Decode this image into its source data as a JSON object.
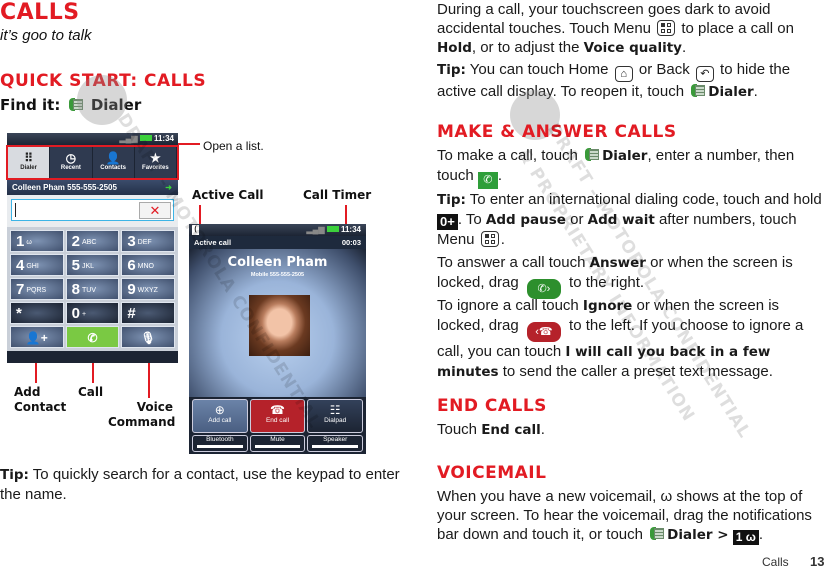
{
  "left": {
    "title": "Calls",
    "subtitle": "it’s goo to talk",
    "quick_start_heading": "Quick Start: Calls",
    "find_it_label": "Find it:",
    "find_it_app": "Dialer",
    "tip_label": "Tip:",
    "tip_text": " To quickly search for a contact, use the keypad to enter the name."
  },
  "phone_dialer": {
    "status_time": "11:34",
    "tabs": [
      {
        "label": "Dialer",
        "icon": "grid-icon",
        "active": true
      },
      {
        "label": "Recent",
        "icon": "clock-icon",
        "active": false
      },
      {
        "label": "Contacts",
        "icon": "person-icon",
        "active": false
      },
      {
        "label": "Favorites",
        "icon": "star-icon",
        "active": false
      }
    ],
    "contact_suggestion": "Colleen Pham 555-555-2505",
    "input_value": "",
    "keys": [
      {
        "digit": "1",
        "letters": "ω"
      },
      {
        "digit": "2",
        "letters": "ABC"
      },
      {
        "digit": "3",
        "letters": "DEF"
      },
      {
        "digit": "4",
        "letters": "GHI"
      },
      {
        "digit": "5",
        "letters": "JKL"
      },
      {
        "digit": "6",
        "letters": "MNO"
      },
      {
        "digit": "7",
        "letters": "PQRS"
      },
      {
        "digit": "8",
        "letters": "TUV"
      },
      {
        "digit": "9",
        "letters": "WXYZ"
      },
      {
        "digit": "*",
        "letters": ""
      },
      {
        "digit": "0",
        "letters": "+"
      },
      {
        "digit": "#",
        "letters": ""
      }
    ],
    "callouts": {
      "open_list": "Open a list.",
      "add_contact": "Add Contact",
      "call": "Call",
      "voice_command": "Voice Command"
    }
  },
  "phone_active": {
    "status_time": "11:34",
    "title": "Active call",
    "timer": "00:03",
    "caller_name": "Colleen Pham",
    "caller_number": "Mobile 555-555-2505",
    "actions": [
      "Add call",
      "End call",
      "Dialpad"
    ],
    "toggles": [
      "Bluetooth",
      "Mute",
      "Speaker"
    ],
    "callouts": {
      "active_call": "Active Call",
      "call_timer": "Call Timer"
    }
  },
  "right": {
    "intro_p1_a": "During a call, your touchscreen goes dark to avoid accidental touches. Touch Menu ",
    "intro_p1_b": " to place a call on ",
    "hold": "Hold",
    "intro_p1_c": ", or to adjust the ",
    "voice_quality": "Voice quality",
    "tip_label": "Tip:",
    "tip2_a": " You can touch Home ",
    "tip2_b": " or Back ",
    "tip2_c": " to hide the active call display. To reopen it, touch ",
    "dialer": "Dialer",
    "make_heading": "Make & Answer Calls",
    "make_a": "To make a call, touch ",
    "make_b": ", enter a number, then touch ",
    "tip3_a": " To enter an international dialing code, touch and hold ",
    "tip3_key": "0+",
    "tip3_b": ". To ",
    "add_pause": "Add pause",
    "tip3_c": " or ",
    "add_wait": "Add wait",
    "tip3_d": " after numbers, touch Menu ",
    "answer_a": "To answer a call touch ",
    "answer": "Answer",
    "answer_b": " or when the screen is locked, drag ",
    "answer_c": " to the right.",
    "ignore_a": "To ignore a call touch ",
    "ignore": "Ignore",
    "ignore_b": " or when the screen is locked, drag ",
    "ignore_c": " to the left. If you choose to ignore a call, you can touch ",
    "ignore_msg": "I will call you back in a few minutes",
    "ignore_d": " to send the caller a preset text message.",
    "end_heading": "End Calls",
    "end_a": "Touch ",
    "end_call": "End call",
    "voicemail_heading": "Voicemail",
    "vm_a": "When you have a new voicemail, ",
    "vm_icon": "ω",
    "vm_b": " shows at the top of your screen. To hear the voicemail, drag the notifications bar down and touch it, or touch ",
    "vm_dialer": "Dialer >",
    "vm_key": "1"
  },
  "footer": {
    "section": "Calls",
    "page": "13"
  },
  "watermark": {
    "line1": "DRAFT - MOTOROLA CONFIDENTIAL",
    "line2": "& PROPRIETARY INFORMATION"
  }
}
